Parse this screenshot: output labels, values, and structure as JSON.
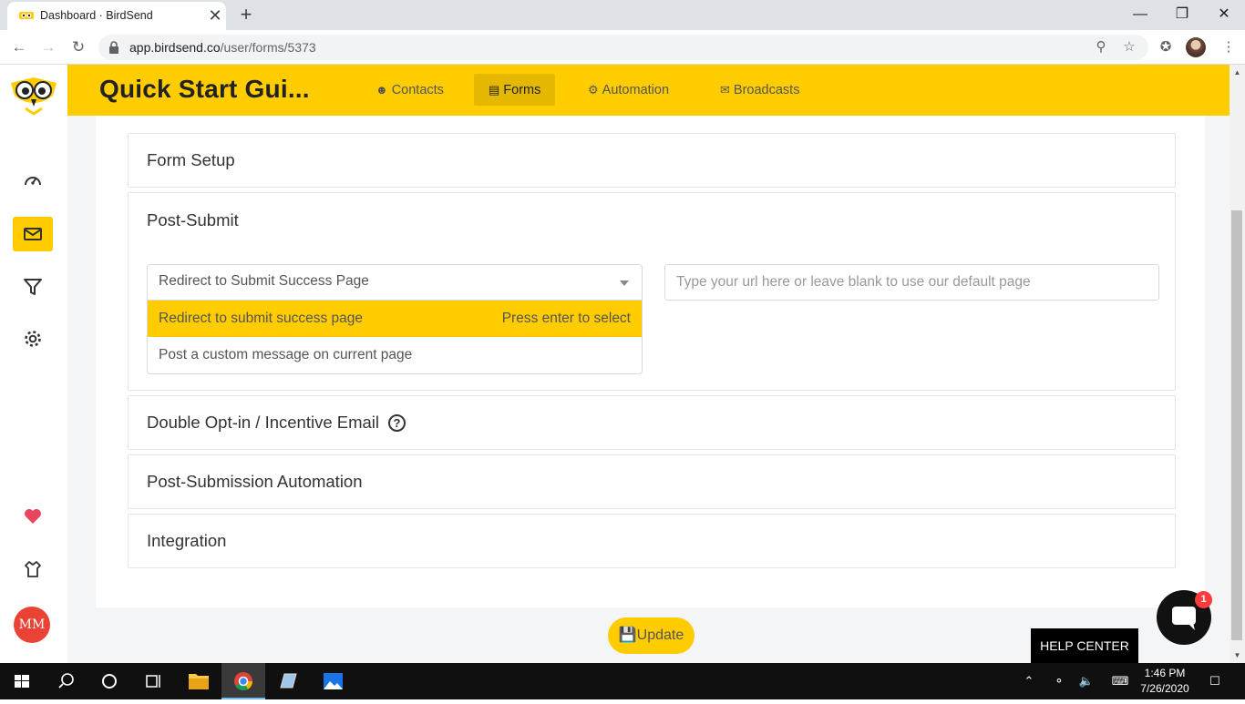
{
  "browser": {
    "tab_title": "Dashboard · BirdSend",
    "tab_close": "✕",
    "new_tab": "+",
    "url_host": "app.birdsend.co",
    "url_path": "/user/forms/5373",
    "window_min": "—",
    "window_max": "❐",
    "window_close": "✕"
  },
  "header": {
    "title": "Quick Start Gui...",
    "nav": [
      {
        "label": "Contacts",
        "icon": "users-icon"
      },
      {
        "label": "Forms",
        "icon": "form-icon",
        "active": true
      },
      {
        "label": "Automation",
        "icon": "gears-icon"
      },
      {
        "label": "Broadcasts",
        "icon": "megaphone-icon"
      }
    ]
  },
  "sidebar": {
    "items": [
      "dashboard-icon",
      "mail-icon",
      "filter-icon",
      "gear-icon"
    ],
    "avatar_initials": "MM"
  },
  "sections": {
    "form_setup": "Form Setup",
    "post_submit": {
      "title": "Post-Submit",
      "select_value": "Redirect to Submit Success Page",
      "options": [
        {
          "label": "Redirect to submit success page",
          "hint": "Press enter to select"
        },
        {
          "label": "Post a custom message on current page"
        }
      ],
      "url_placeholder": "Type your url here or leave blank to use our default page"
    },
    "double_optin": "Double Opt-in / Incentive Email",
    "help_glyph": "?",
    "post_submission_automation": "Post-Submission Automation",
    "integration": "Integration"
  },
  "update_button": "Update",
  "chat": {
    "badge": "1",
    "help_center": "HELP CENTER"
  },
  "taskbar": {
    "time": "1:46 PM",
    "date": "7/26/2020"
  },
  "colors": {
    "brand_yellow": "#ffcc00",
    "heart_red": "#e94560",
    "avatar_red": "#ea4335"
  }
}
